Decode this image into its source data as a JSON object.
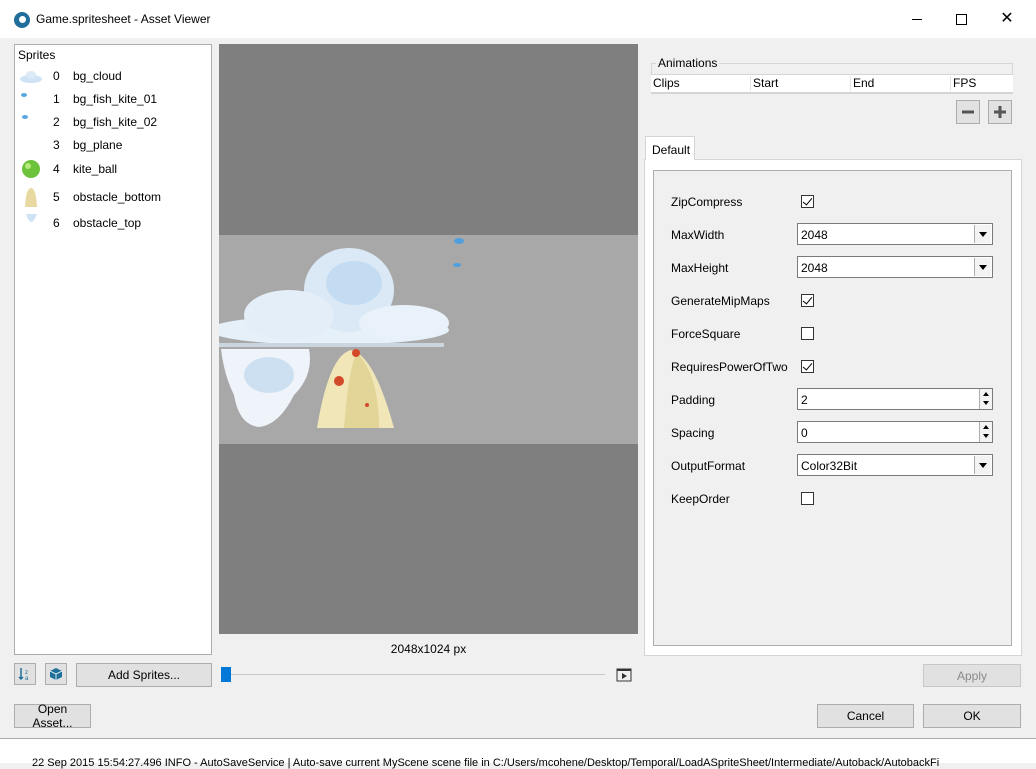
{
  "window": {
    "title": "Game.spritesheet - Asset Viewer",
    "controls": {
      "minimize": "minimize-icon",
      "maximize": "maximize-icon",
      "close": "✕"
    }
  },
  "sprites": {
    "header": "Sprites",
    "items": [
      {
        "index": "0",
        "name": "bg_cloud"
      },
      {
        "index": "1",
        "name": "bg_fish_kite_01"
      },
      {
        "index": "2",
        "name": "bg_fish_kite_02"
      },
      {
        "index": "3",
        "name": "bg_plane"
      },
      {
        "index": "4",
        "name": "kite_ball"
      },
      {
        "index": "5",
        "name": "obstacle_bottom"
      },
      {
        "index": "6",
        "name": "obstacle_top"
      }
    ]
  },
  "preview": {
    "size_label": "2048x1024 px"
  },
  "toolbar": {
    "add_sprites": "Add Sprites..."
  },
  "animations": {
    "title": "Animations",
    "columns": [
      "Clips",
      "Start",
      "End",
      "FPS"
    ]
  },
  "tabs": [
    "Default"
  ],
  "settings": {
    "zip_compress": {
      "label": "ZipCompress",
      "checked": true
    },
    "max_width": {
      "label": "MaxWidth",
      "value": "2048"
    },
    "max_height": {
      "label": "MaxHeight",
      "value": "2048"
    },
    "generate_mipmaps": {
      "label": "GenerateMipMaps",
      "checked": true
    },
    "force_square": {
      "label": "ForceSquare",
      "checked": false
    },
    "requires_pow2": {
      "label": "RequiresPowerOfTwo",
      "checked": true
    },
    "padding": {
      "label": "Padding",
      "value": "2"
    },
    "spacing": {
      "label": "Spacing",
      "value": "0"
    },
    "output_format": {
      "label": "OutputFormat",
      "value": "Color32Bit"
    },
    "keep_order": {
      "label": "KeepOrder",
      "checked": false
    }
  },
  "buttons": {
    "apply": "Apply",
    "open_asset": "Open Asset...",
    "cancel": "Cancel",
    "ok": "OK"
  },
  "log": {
    "text": "22 Sep 2015 15:54:27.496 INFO - AutoSaveService | Auto-save current MyScene scene file in C:/Users/mcohene/Desktop/Temporal/LoadASpriteSheet/Intermediate/Autoback/AutobackFi"
  },
  "colors": {
    "accent": "#0078d7",
    "preview_bg": "#7f7f7f",
    "sheet_bg": "#a8a8a8"
  }
}
